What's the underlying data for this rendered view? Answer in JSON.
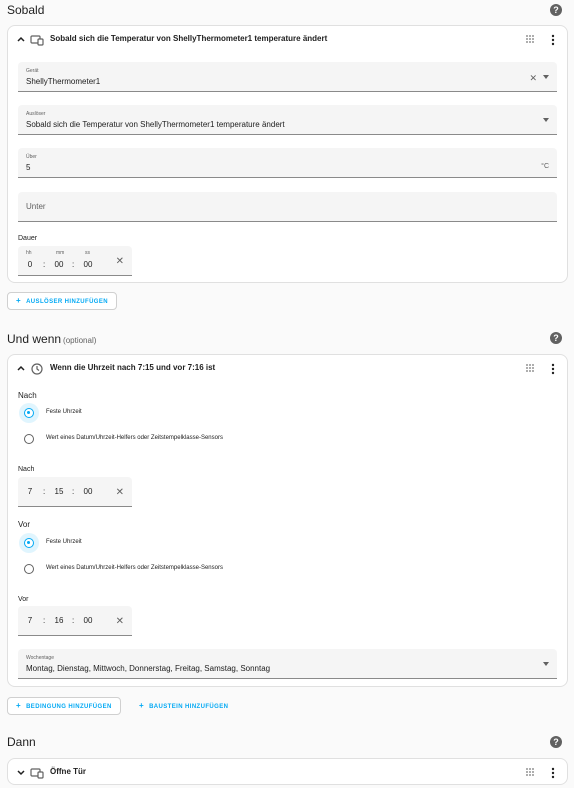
{
  "sobald": {
    "title": "Sobald",
    "card": {
      "title": "Sobald sich die Temperatur von ShellyThermometer1 temperature ändert",
      "device": {
        "label": "Gerät",
        "value": "ShellyThermometer1"
      },
      "trigger": {
        "label": "Auslöser",
        "value": "Sobald sich die Temperatur von ShellyThermometer1 temperature ändert"
      },
      "above": {
        "label": "Über",
        "value": "5",
        "unit": "°C"
      },
      "below": {
        "placeholder": "Unter"
      },
      "duration": {
        "label": "Dauer",
        "units": {
          "hh": "hh",
          "mm": "mm",
          "ss": "ss"
        },
        "hh": "0",
        "mm": "00",
        "ss": "00"
      }
    },
    "add_button": "AUSLÖSER HINZUFÜGEN"
  },
  "undwenn": {
    "title": "Und wenn",
    "optional": "(optional)",
    "card": {
      "title": "Wenn die Uhrzeit nach 7:15 und vor 7:16 ist",
      "after": {
        "label": "Nach",
        "option_fixed": "Feste Uhrzeit",
        "option_helper": "Wert eines Datum/Uhrzeit-Helfers oder Zeitstempelklasse-Sensors",
        "time_label": "Nach",
        "hh": "7",
        "mm": "15",
        "ss": "00"
      },
      "before": {
        "label": "Vor",
        "option_fixed": "Feste Uhrzeit",
        "option_helper": "Wert eines Datum/Uhrzeit-Helfers oder Zeitstempelklasse-Sensors",
        "time_label": "Vor",
        "hh": "7",
        "mm": "16",
        "ss": "00"
      },
      "weekdays": {
        "label": "Wochentage",
        "value": "Montag, Dienstag, Mittwoch, Donnerstag, Freitag, Samstag, Sonntag"
      }
    },
    "add_condition": "BEDINGUNG HINZUFÜGEN",
    "add_block": "BAUSTEIN HINZUFÜGEN"
  },
  "dann": {
    "title": "Dann",
    "card": {
      "title": "Öffne Tür"
    }
  },
  "colors": {
    "accent": "#03a9f4",
    "text": "#212121",
    "muted": "#616161",
    "field_bg": "#f5f5f5"
  },
  "icons": [
    "help-icon",
    "chevron-up-icon",
    "device-icon",
    "drag-handle-icon",
    "more-vert-icon",
    "clock-icon",
    "close-icon",
    "dropdown-arrow-icon",
    "plus-icon",
    "chevron-down-icon"
  ]
}
